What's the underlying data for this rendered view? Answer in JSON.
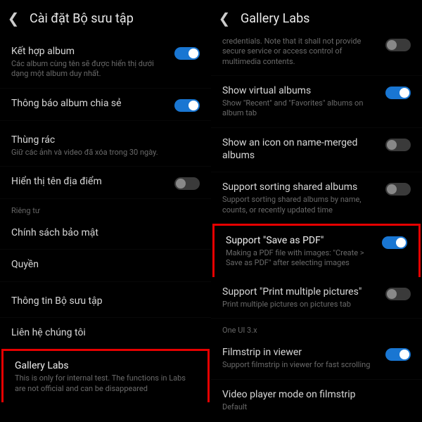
{
  "left": {
    "header_title": "Cài đặt Bộ sưu tập",
    "items": {
      "combine": {
        "title": "Kết hợp album",
        "sub": "Các album cùng tên sẽ được hiển thị dưới dạng một album duy nhất."
      },
      "shared_notif": {
        "title": "Thông báo album chia sẻ"
      },
      "trash": {
        "title": "Thùng rác",
        "sub": "Giữ các ảnh và video đã xóa trong 30 ngày."
      },
      "location": {
        "title": "Hiển thị tên địa điểm"
      },
      "section_privacy": "Riêng tư",
      "privacy_policy": {
        "title": "Chính sách bảo mật"
      },
      "permissions": {
        "title": "Quyền"
      },
      "about": {
        "title": "Thông tin Bộ sưu tập"
      },
      "contact": {
        "title": "Liên hệ chúng tôi"
      },
      "labs": {
        "title": "Gallery Labs",
        "sub": "This is only for internal test. The functions in Labs are not official and can be disappeared"
      }
    }
  },
  "right": {
    "header_title": "Gallery Labs",
    "items": {
      "cutoff": {
        "sub": "credentials. Note that it shall not provide secure service or access control of multimedia contents."
      },
      "virtual": {
        "title": "Show virtual albums",
        "sub": "Show \"Recent\" and \"Favorites\" albums on album tab"
      },
      "icon_merged": {
        "title": "Show an icon on name-merged albums"
      },
      "sort_shared": {
        "title": "Support sorting shared albums",
        "sub": "Support sorting shared albums by name, counts, or recently updated time"
      },
      "save_pdf": {
        "title": "Support \"Save as PDF\"",
        "sub": "Making a PDF file with images: \"Create > Save as PDF\" after selecting images"
      },
      "print_multi": {
        "title": "Support \"Print multiple pictures\"",
        "sub": "Print multiple pictures on pictures tab"
      },
      "section_oneui": "One UI 3.x",
      "filmstrip": {
        "title": "Filmstrip in viewer",
        "sub": "Support filmstrip in viewer for fast scrolling"
      },
      "video_filmstrip": {
        "title": "Video player mode on filmstrip",
        "sub": "Default"
      }
    }
  }
}
